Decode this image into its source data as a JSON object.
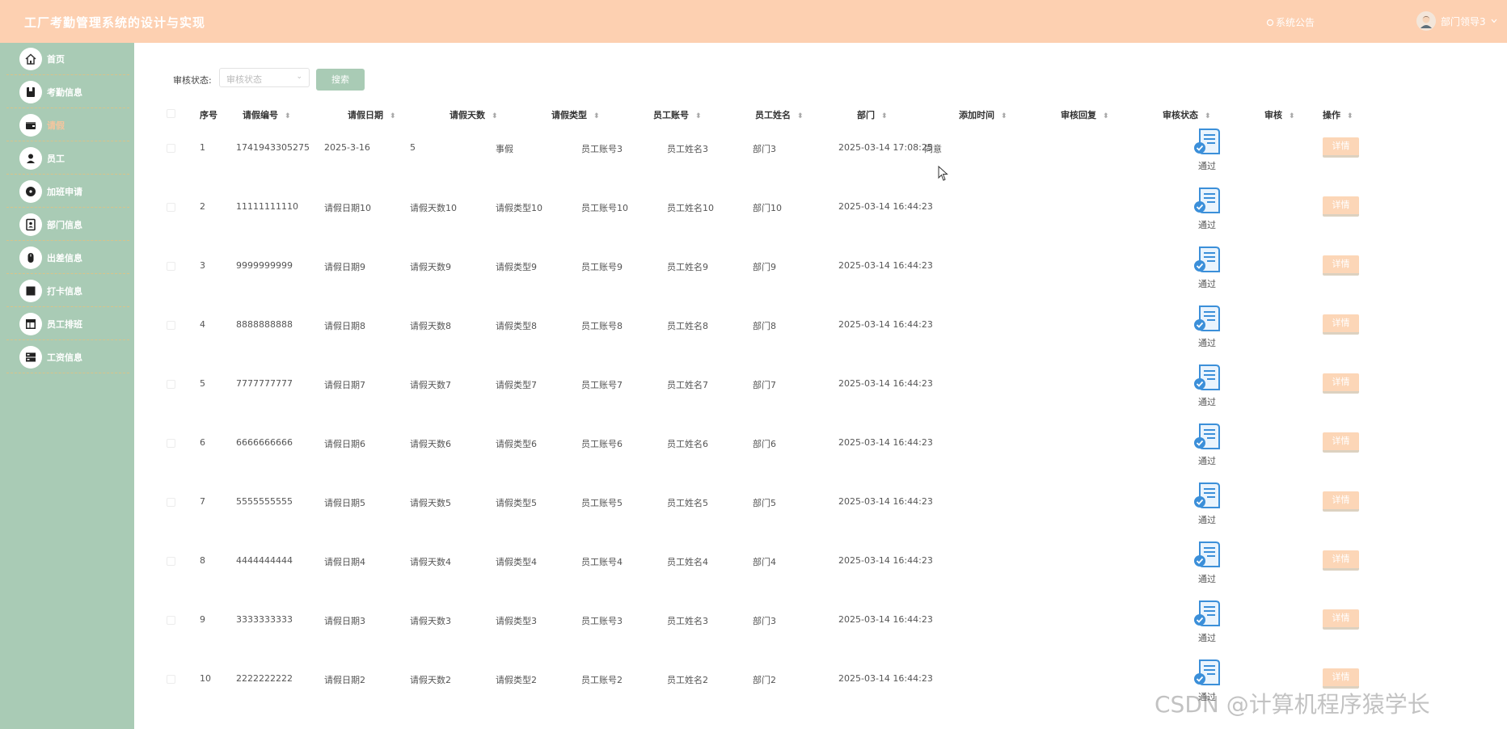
{
  "header": {
    "title": "工厂考勤管理系统的设计与实现",
    "notice_label": "系统公告",
    "user_name": "部门领导3"
  },
  "sidebar": {
    "items": [
      {
        "label": "首页",
        "icon": "home-icon"
      },
      {
        "label": "考勤信息",
        "icon": "book-icon"
      },
      {
        "label": "请假",
        "icon": "wallet-icon",
        "active": true
      },
      {
        "label": "员工",
        "icon": "user-icon"
      },
      {
        "label": "加班申请",
        "icon": "disc-icon"
      },
      {
        "label": "部门信息",
        "icon": "contact-icon"
      },
      {
        "label": "出差信息",
        "icon": "mouse-icon"
      },
      {
        "label": "打卡信息",
        "icon": "square-icon"
      },
      {
        "label": "员工排班",
        "icon": "layout-icon"
      },
      {
        "label": "工资信息",
        "icon": "server-icon"
      }
    ]
  },
  "filter": {
    "label": "审核状态:",
    "placeholder": "审核状态",
    "search_label": "搜索"
  },
  "table": {
    "columns": [
      "序号",
      "请假编号",
      "请假日期",
      "请假天数",
      "请假类型",
      "员工账号",
      "员工姓名",
      "部门",
      "添加时间",
      "审核回复",
      "审核状态",
      "审核",
      "操作"
    ],
    "rows": [
      {
        "index": "1",
        "code": "1741943305275",
        "date": "2025-3-16",
        "days": "5",
        "type": "事假",
        "account": "员工账号3",
        "name": "员工姓名3",
        "dept": "部门3",
        "added": "2025-03-14 17:08:25",
        "reply": "同意",
        "status": "通过"
      },
      {
        "index": "2",
        "code": "11111111110",
        "date": "请假日期10",
        "days": "请假天数10",
        "type": "请假类型10",
        "account": "员工账号10",
        "name": "员工姓名10",
        "dept": "部门10",
        "added": "2025-03-14 16:44:23",
        "reply": "",
        "status": "通过"
      },
      {
        "index": "3",
        "code": "9999999999",
        "date": "请假日期9",
        "days": "请假天数9",
        "type": "请假类型9",
        "account": "员工账号9",
        "name": "员工姓名9",
        "dept": "部门9",
        "added": "2025-03-14 16:44:23",
        "reply": "",
        "status": "通过"
      },
      {
        "index": "4",
        "code": "8888888888",
        "date": "请假日期8",
        "days": "请假天数8",
        "type": "请假类型8",
        "account": "员工账号8",
        "name": "员工姓名8",
        "dept": "部门8",
        "added": "2025-03-14 16:44:23",
        "reply": "",
        "status": "通过"
      },
      {
        "index": "5",
        "code": "7777777777",
        "date": "请假日期7",
        "days": "请假天数7",
        "type": "请假类型7",
        "account": "员工账号7",
        "name": "员工姓名7",
        "dept": "部门7",
        "added": "2025-03-14 16:44:23",
        "reply": "",
        "status": "通过"
      },
      {
        "index": "6",
        "code": "6666666666",
        "date": "请假日期6",
        "days": "请假天数6",
        "type": "请假类型6",
        "account": "员工账号6",
        "name": "员工姓名6",
        "dept": "部门6",
        "added": "2025-03-14 16:44:23",
        "reply": "",
        "status": "通过"
      },
      {
        "index": "7",
        "code": "5555555555",
        "date": "请假日期5",
        "days": "请假天数5",
        "type": "请假类型5",
        "account": "员工账号5",
        "name": "员工姓名5",
        "dept": "部门5",
        "added": "2025-03-14 16:44:23",
        "reply": "",
        "status": "通过"
      },
      {
        "index": "8",
        "code": "4444444444",
        "date": "请假日期4",
        "days": "请假天数4",
        "type": "请假类型4",
        "account": "员工账号4",
        "name": "员工姓名4",
        "dept": "部门4",
        "added": "2025-03-14 16:44:23",
        "reply": "",
        "status": "通过"
      },
      {
        "index": "9",
        "code": "3333333333",
        "date": "请假日期3",
        "days": "请假天数3",
        "type": "请假类型3",
        "account": "员工账号3",
        "name": "员工姓名3",
        "dept": "部门3",
        "added": "2025-03-14 16:44:23",
        "reply": "",
        "status": "通过"
      },
      {
        "index": "10",
        "code": "2222222222",
        "date": "请假日期2",
        "days": "请假天数2",
        "type": "请假类型2",
        "account": "员工账号2",
        "name": "员工姓名2",
        "dept": "部门2",
        "added": "2025-03-14 16:44:23",
        "reply": "",
        "status": "通过"
      }
    ],
    "detail_label": "详情"
  },
  "watermark": "CSDN @计算机程序猿学长",
  "colors": {
    "header": "#fdd0b1",
    "sidebar": "#a9cbb5",
    "active_nav": "#f6c59d",
    "detail_button": "#fcd6b7",
    "status_icon": "#3b8fd9"
  }
}
